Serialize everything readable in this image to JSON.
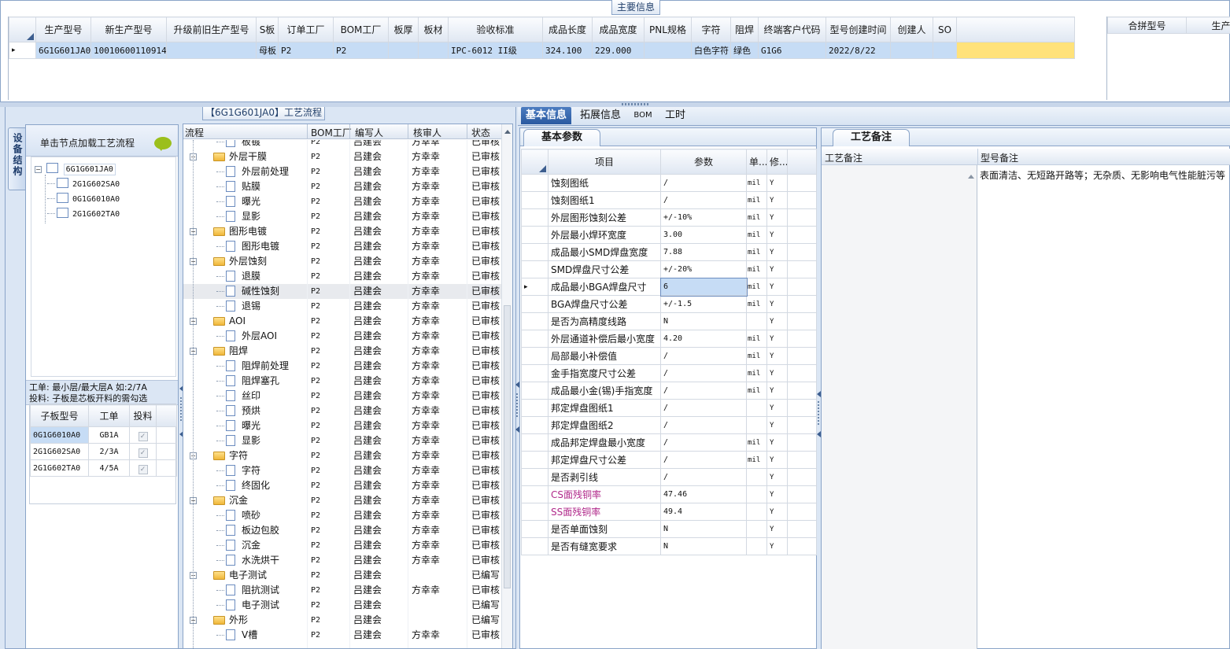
{
  "main_info": {
    "title": "主要信息",
    "columns": [
      "生产型号",
      "新生产型号",
      "升级前旧生产型号",
      "S板",
      "订单工厂",
      "BOM工厂",
      "板厚",
      "板材",
      "验收标准",
      "成品长度",
      "成品宽度",
      "PNL规格",
      "字符",
      "阻焊",
      "终端客户代码",
      "型号创建时间",
      "创建人",
      "SO"
    ],
    "row": [
      "6G1G601JA0",
      "10010600110914",
      "",
      "母板",
      "P2",
      "P2",
      "",
      "",
      "IPC-6012 II级",
      "324.100",
      "229.000",
      "",
      "白色字符",
      "绿色",
      "G1G6",
      "2022/8/22",
      "",
      ""
    ],
    "row_marker": "▸",
    "right_columns": [
      "合拼型号",
      "生产型"
    ]
  },
  "process": {
    "title": "【6G1G601JA0】工艺流程",
    "side_tab": "设备结构",
    "load_hint": "单击节点加载工艺流程",
    "tree": {
      "root": "6G1G601JA0",
      "children": [
        "2G1G602SA0",
        "0G1G6010A0",
        "2G1G602TA0"
      ]
    },
    "note_line1": "工单: 最小层/最大层A 如:2/7A",
    "note_line2": "投料: 子板是芯板开料的需勾选",
    "sub_table": {
      "columns": [
        "子板型号",
        "工单",
        "投料"
      ],
      "rows": [
        [
          "0G1G6010A0",
          "GB1A",
          "✓"
        ],
        [
          "2G1G602SA0",
          "2/3A",
          "✓"
        ],
        [
          "2G1G602TA0",
          "4/5A",
          "✓"
        ]
      ]
    },
    "flow_columns": [
      "流程",
      "BOM工厂",
      "编写人",
      "核审人",
      "状态"
    ],
    "flow_rows": [
      {
        "name": "板镀",
        "level": 2,
        "bom": "P2",
        "writer": "吕建会",
        "reviewer": "方幸幸",
        "status": "已审核"
      },
      {
        "name": "外层干膜",
        "level": 1,
        "bom": "P2",
        "writer": "吕建会",
        "reviewer": "方幸幸",
        "status": "已审核"
      },
      {
        "name": "外层前处理",
        "level": 2,
        "bom": "P2",
        "writer": "吕建会",
        "reviewer": "方幸幸",
        "status": "已审核"
      },
      {
        "name": "贴膜",
        "level": 2,
        "bom": "P2",
        "writer": "吕建会",
        "reviewer": "方幸幸",
        "status": "已审核"
      },
      {
        "name": "曝光",
        "level": 2,
        "bom": "P2",
        "writer": "吕建会",
        "reviewer": "方幸幸",
        "status": "已审核"
      },
      {
        "name": "显影",
        "level": 2,
        "bom": "P2",
        "writer": "吕建会",
        "reviewer": "方幸幸",
        "status": "已审核"
      },
      {
        "name": "图形电镀",
        "level": 1,
        "bom": "P2",
        "writer": "吕建会",
        "reviewer": "方幸幸",
        "status": "已审核"
      },
      {
        "name": "图形电镀",
        "level": 2,
        "bom": "P2",
        "writer": "吕建会",
        "reviewer": "方幸幸",
        "status": "已审核"
      },
      {
        "name": "外层蚀刻",
        "level": 1,
        "bom": "P2",
        "writer": "吕建会",
        "reviewer": "方幸幸",
        "status": "已审核"
      },
      {
        "name": "退膜",
        "level": 2,
        "bom": "P2",
        "writer": "吕建会",
        "reviewer": "方幸幸",
        "status": "已审核"
      },
      {
        "name": "碱性蚀刻",
        "level": 2,
        "bom": "P2",
        "writer": "吕建会",
        "reviewer": "方幸幸",
        "status": "已审核",
        "selected": true
      },
      {
        "name": "退锡",
        "level": 2,
        "bom": "P2",
        "writer": "吕建会",
        "reviewer": "方幸幸",
        "status": "已审核"
      },
      {
        "name": "AOI",
        "level": 1,
        "bom": "P2",
        "writer": "吕建会",
        "reviewer": "方幸幸",
        "status": "已审核"
      },
      {
        "name": "外层AOI",
        "level": 2,
        "bom": "P2",
        "writer": "吕建会",
        "reviewer": "方幸幸",
        "status": "已审核"
      },
      {
        "name": "阻焊",
        "level": 1,
        "bom": "P2",
        "writer": "吕建会",
        "reviewer": "方幸幸",
        "status": "已审核"
      },
      {
        "name": "阻焊前处理",
        "level": 2,
        "bom": "P2",
        "writer": "吕建会",
        "reviewer": "方幸幸",
        "status": "已审核"
      },
      {
        "name": "阻焊塞孔",
        "level": 2,
        "bom": "P2",
        "writer": "吕建会",
        "reviewer": "方幸幸",
        "status": "已审核"
      },
      {
        "name": "丝印",
        "level": 2,
        "bom": "P2",
        "writer": "吕建会",
        "reviewer": "方幸幸",
        "status": "已审核"
      },
      {
        "name": "预烘",
        "level": 2,
        "bom": "P2",
        "writer": "吕建会",
        "reviewer": "方幸幸",
        "status": "已审核"
      },
      {
        "name": "曝光",
        "level": 2,
        "bom": "P2",
        "writer": "吕建会",
        "reviewer": "方幸幸",
        "status": "已审核"
      },
      {
        "name": "显影",
        "level": 2,
        "bom": "P2",
        "writer": "吕建会",
        "reviewer": "方幸幸",
        "status": "已审核"
      },
      {
        "name": "字符",
        "level": 1,
        "bom": "P2",
        "writer": "吕建会",
        "reviewer": "方幸幸",
        "status": "已审核"
      },
      {
        "name": "字符",
        "level": 2,
        "bom": "P2",
        "writer": "吕建会",
        "reviewer": "方幸幸",
        "status": "已审核"
      },
      {
        "name": "终固化",
        "level": 2,
        "bom": "P2",
        "writer": "吕建会",
        "reviewer": "方幸幸",
        "status": "已审核"
      },
      {
        "name": "沉金",
        "level": 1,
        "bom": "P2",
        "writer": "吕建会",
        "reviewer": "方幸幸",
        "status": "已审核"
      },
      {
        "name": "喷砂",
        "level": 2,
        "bom": "P2",
        "writer": "吕建会",
        "reviewer": "方幸幸",
        "status": "已审核"
      },
      {
        "name": "板边包胶",
        "level": 2,
        "bom": "P2",
        "writer": "吕建会",
        "reviewer": "方幸幸",
        "status": "已审核"
      },
      {
        "name": "沉金",
        "level": 2,
        "bom": "P2",
        "writer": "吕建会",
        "reviewer": "方幸幸",
        "status": "已审核"
      },
      {
        "name": "水洗烘干",
        "level": 2,
        "bom": "P2",
        "writer": "吕建会",
        "reviewer": "方幸幸",
        "status": "已审核"
      },
      {
        "name": "电子测试",
        "level": 1,
        "bom": "P2",
        "writer": "吕建会",
        "reviewer": "",
        "status": "已编写"
      },
      {
        "name": "阻抗测试",
        "level": 2,
        "bom": "P2",
        "writer": "吕建会",
        "reviewer": "方幸幸",
        "status": "已审核"
      },
      {
        "name": "电子测试",
        "level": 2,
        "bom": "P2",
        "writer": "吕建会",
        "reviewer": "",
        "status": "已编写"
      },
      {
        "name": "外形",
        "level": 1,
        "bom": "P2",
        "writer": "吕建会",
        "reviewer": "",
        "status": "已编写"
      },
      {
        "name": "V槽",
        "level": 2,
        "bom": "P2",
        "writer": "吕建会",
        "reviewer": "方幸幸",
        "status": "已审核"
      }
    ]
  },
  "tabs": [
    "基本信息",
    "拓展信息",
    "BOM",
    "工时"
  ],
  "params": {
    "title": "基本参数",
    "columns": [
      "项目",
      "参数",
      "单...",
      "修..."
    ],
    "rows": [
      {
        "item": "蚀刻图纸",
        "value": "/",
        "unit": "mil",
        "mod": "Y"
      },
      {
        "item": "蚀刻图纸1",
        "value": "/",
        "unit": "mil",
        "mod": "Y"
      },
      {
        "item": "外层图形蚀刻公差",
        "value": "+/-10%",
        "unit": "mil",
        "mod": "Y"
      },
      {
        "item": "外层最小焊环宽度",
        "value": "3.00",
        "unit": "mil",
        "mod": "Y"
      },
      {
        "item": "成品最小SMD焊盘宽度",
        "value": "7.88",
        "unit": "mil",
        "mod": "Y"
      },
      {
        "item": "SMD焊盘尺寸公差",
        "value": "+/-20%",
        "unit": "mil",
        "mod": "Y"
      },
      {
        "item": "成品最小BGA焊盘尺寸",
        "value": "6",
        "unit": "mil",
        "mod": "Y",
        "selected": true
      },
      {
        "item": "BGA焊盘尺寸公差",
        "value": "+/-1.5",
        "unit": "mil",
        "mod": "Y"
      },
      {
        "item": "是否为高精度线路",
        "value": "N",
        "unit": "",
        "mod": "Y"
      },
      {
        "item": "外层通道补偿后最小宽度",
        "value": "4.20",
        "unit": "mil",
        "mod": "Y"
      },
      {
        "item": "局部最小补偿值",
        "value": "/",
        "unit": "mil",
        "mod": "Y"
      },
      {
        "item": "金手指宽度尺寸公差",
        "value": "/",
        "unit": "mil",
        "mod": "Y"
      },
      {
        "item": "成品最小金(锡)手指宽度",
        "value": "/",
        "unit": "mil",
        "mod": "Y"
      },
      {
        "item": "邦定焊盘图纸1",
        "value": "/",
        "unit": "",
        "mod": "Y"
      },
      {
        "item": "邦定焊盘图纸2",
        "value": "/",
        "unit": "",
        "mod": "Y"
      },
      {
        "item": "成品邦定焊盘最小宽度",
        "value": "/",
        "unit": "mil",
        "mod": "Y"
      },
      {
        "item": "邦定焊盘尺寸公差",
        "value": "/",
        "unit": "mil",
        "mod": "Y"
      },
      {
        "item": "是否剥引线",
        "value": "/",
        "unit": "",
        "mod": "Y"
      },
      {
        "item": "CS面残铜率",
        "value": "47.46",
        "unit": "",
        "mod": "Y",
        "highlight": true
      },
      {
        "item": "SS面残铜率",
        "value": "49.4",
        "unit": "",
        "mod": "Y",
        "highlight": true
      },
      {
        "item": "是否单面蚀刻",
        "value": "N",
        "unit": "",
        "mod": "Y"
      },
      {
        "item": "是否有缝宽要求",
        "value": "N",
        "unit": "",
        "mod": "Y"
      }
    ],
    "row_marker": "▸"
  },
  "remarks": {
    "title": "工艺备注",
    "col1": "工艺备注",
    "col2": "型号备注",
    "model_remark": "表面清洁、无短路开路等；无杂质、无影响电气性能脏污等"
  },
  "colors": {
    "accent": "#2a5aa0",
    "selected_row": "#c6dcf5",
    "highlight_text": "#b0288a",
    "yellow_cell": "#ffe27a"
  }
}
